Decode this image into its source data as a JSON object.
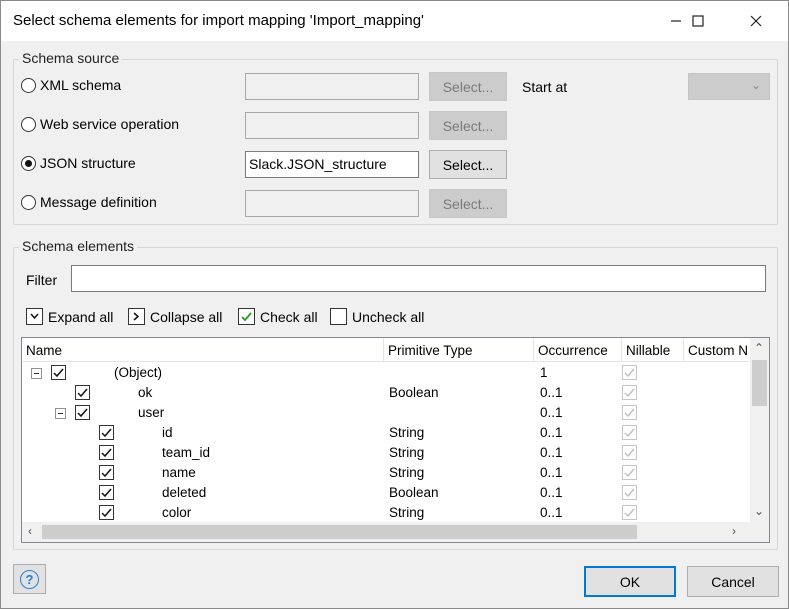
{
  "window": {
    "title": "Select schema elements for import mapping 'Import_mapping'"
  },
  "schema_source": {
    "legend": "Schema source",
    "options": [
      {
        "label": "XML schema",
        "selected": false,
        "value": "",
        "button": "Select..."
      },
      {
        "label": "Web service operation",
        "selected": false,
        "value": "",
        "button": "Select..."
      },
      {
        "label": "JSON structure",
        "selected": true,
        "value": "Slack.JSON_structure",
        "button": "Select..."
      },
      {
        "label": "Message definition",
        "selected": false,
        "value": "",
        "button": "Select..."
      }
    ],
    "start_at_label": "Start at",
    "start_at_value": ""
  },
  "schema_elements": {
    "legend": "Schema elements",
    "filter_label": "Filter",
    "filter_value": "",
    "toolbar": {
      "expand_all": "Expand all",
      "collapse_all": "Collapse all",
      "check_all": "Check all",
      "uncheck_all": "Uncheck all"
    },
    "columns": [
      "Name",
      "Primitive Type",
      "Occurrence",
      "Nillable",
      "Custom N"
    ],
    "rows": [
      {
        "name": "(Object)",
        "type": "",
        "occurrence": "1",
        "level": 0,
        "expandable": true,
        "checked": true
      },
      {
        "name": "ok",
        "type": "Boolean",
        "occurrence": "0..1",
        "level": 1,
        "expandable": false,
        "checked": true
      },
      {
        "name": "user",
        "type": "",
        "occurrence": "0..1",
        "level": 1,
        "expandable": true,
        "checked": true
      },
      {
        "name": "id",
        "type": "String",
        "occurrence": "0..1",
        "level": 2,
        "expandable": false,
        "checked": true
      },
      {
        "name": "team_id",
        "type": "String",
        "occurrence": "0..1",
        "level": 2,
        "expandable": false,
        "checked": true
      },
      {
        "name": "name",
        "type": "String",
        "occurrence": "0..1",
        "level": 2,
        "expandable": false,
        "checked": true
      },
      {
        "name": "deleted",
        "type": "Boolean",
        "occurrence": "0..1",
        "level": 2,
        "expandable": false,
        "checked": true
      },
      {
        "name": "color",
        "type": "String",
        "occurrence": "0..1",
        "level": 2,
        "expandable": false,
        "checked": true
      }
    ]
  },
  "footer": {
    "ok": "OK",
    "cancel": "Cancel"
  },
  "colors": {
    "accent": "#0078d7",
    "checkmark": "#2a9d2a",
    "help": "#2b7fd1"
  }
}
